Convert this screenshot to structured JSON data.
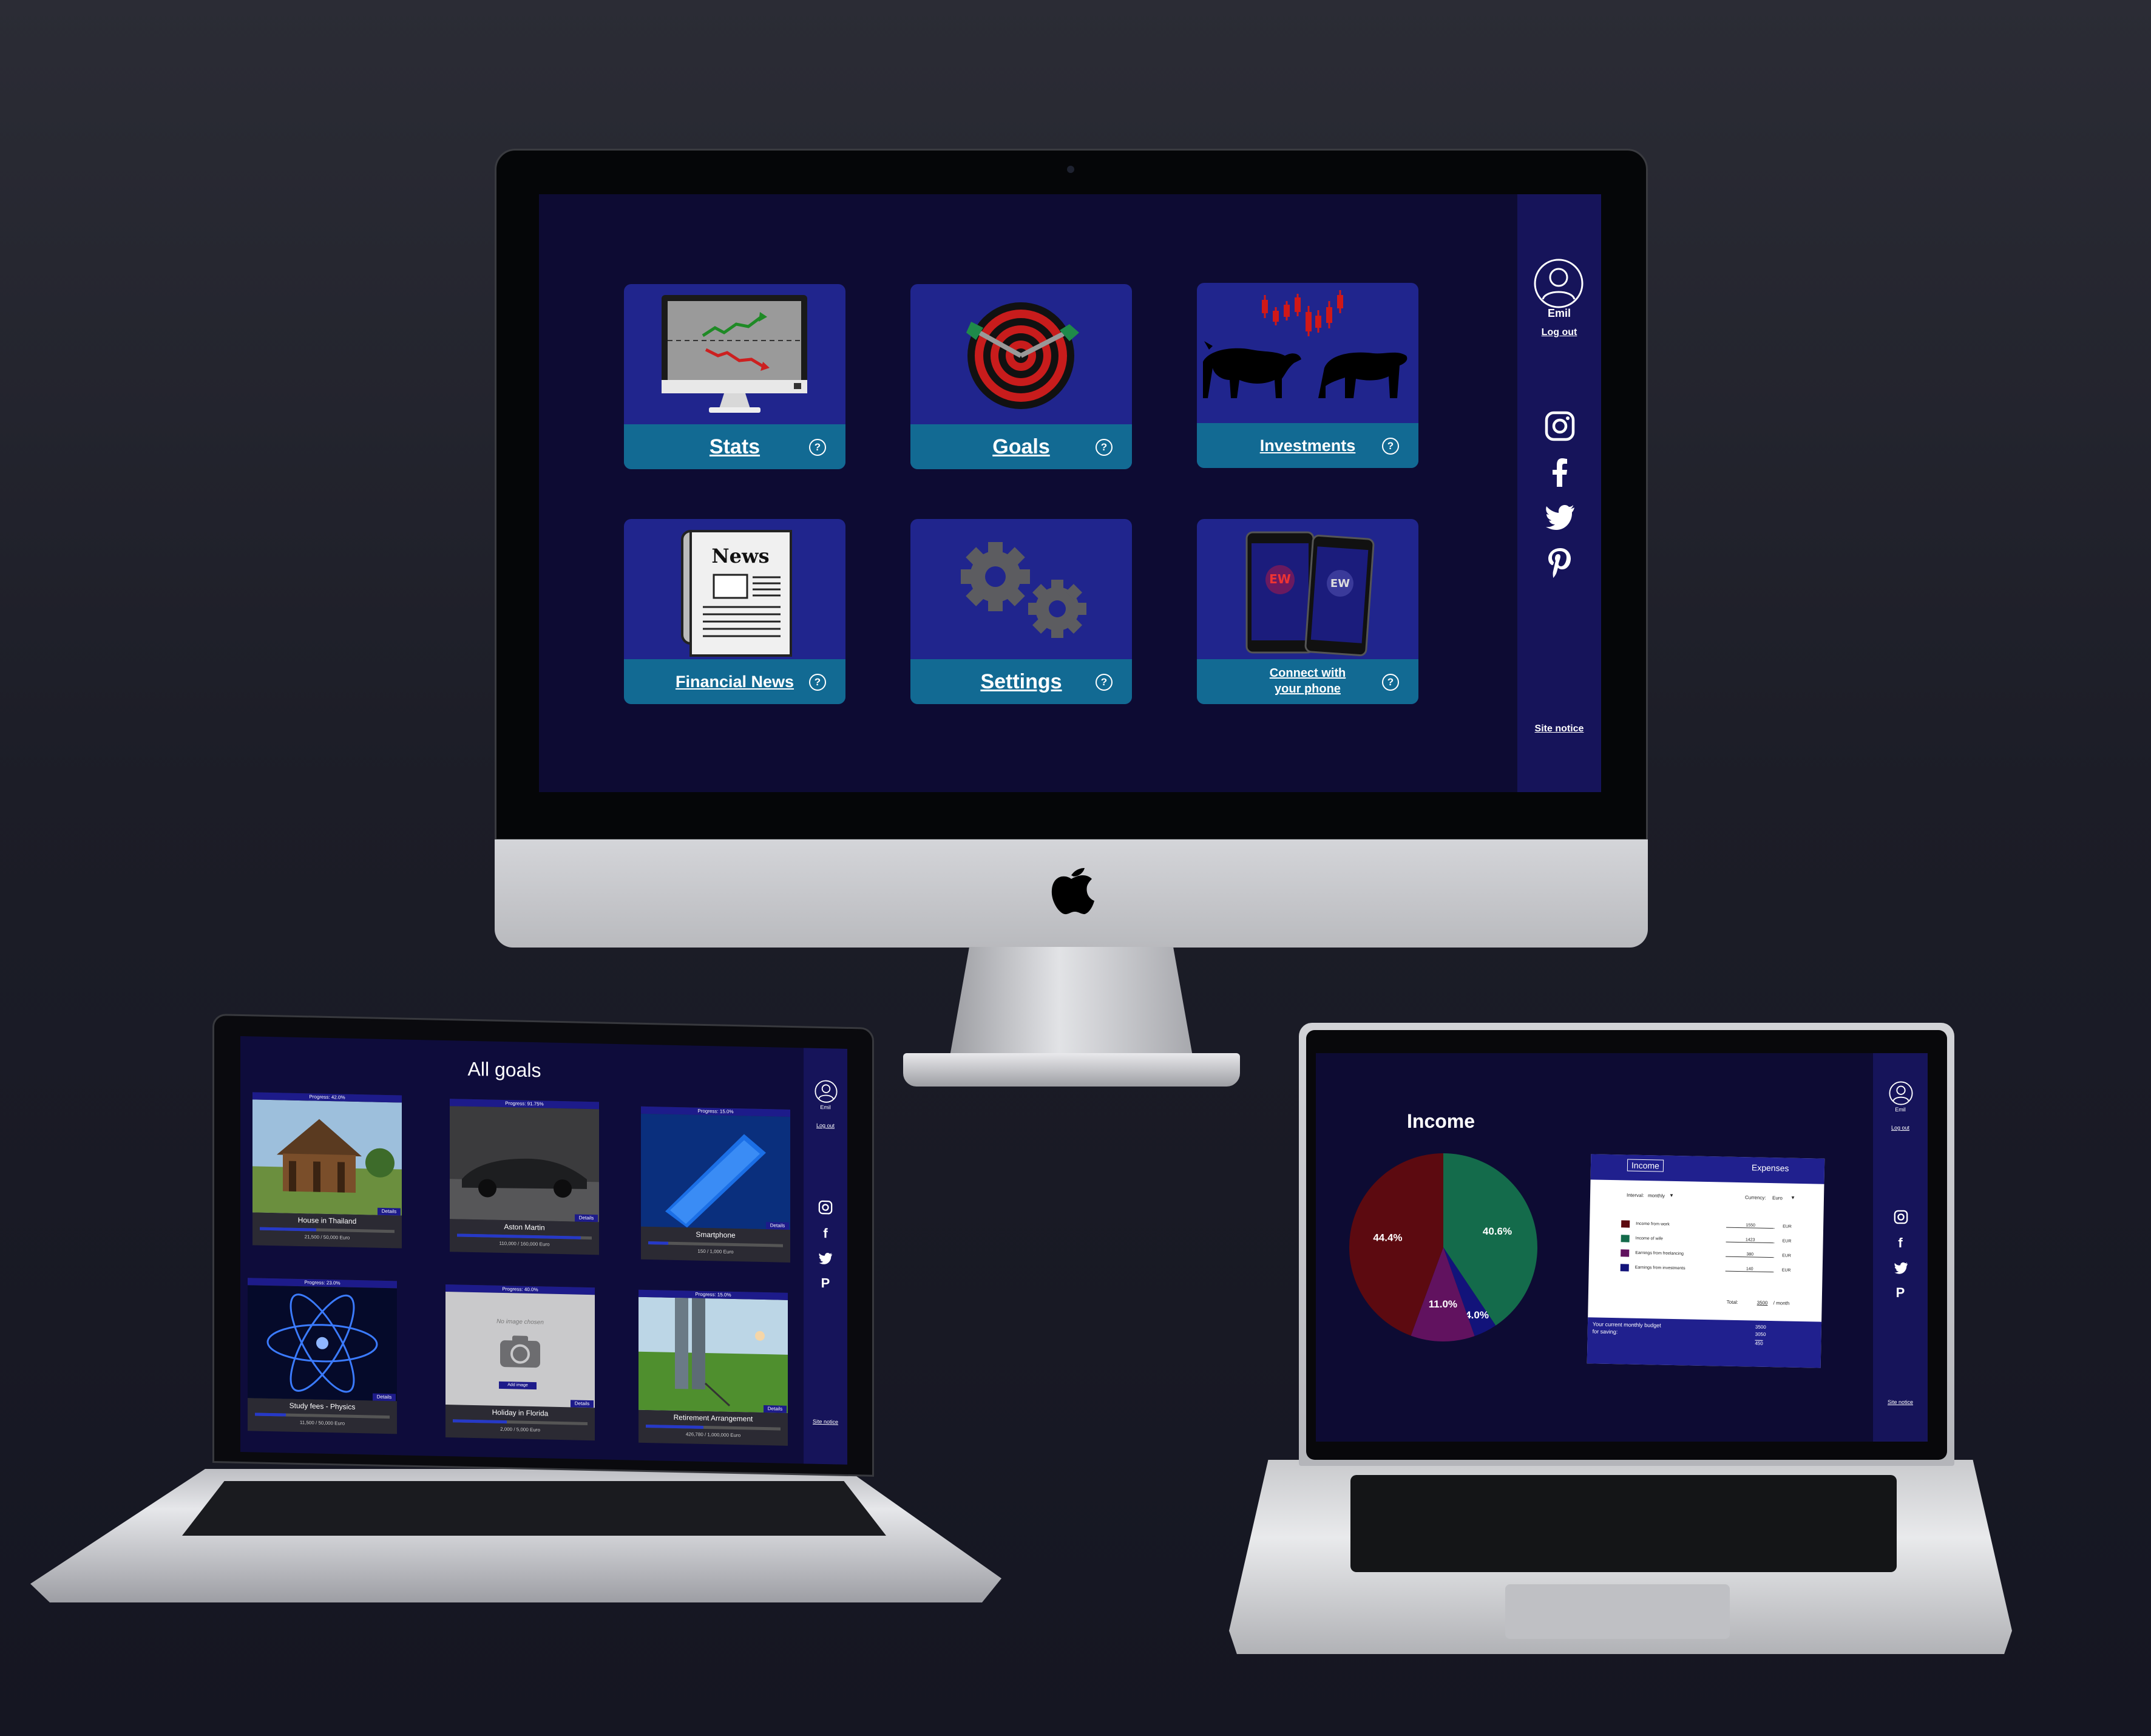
{
  "colors": {
    "tile_blue": "#20258d",
    "tile_bar": "#126a93",
    "screen_bg": "#0d0b33",
    "sidebar": "#16145a",
    "pie_wine": "#5c0a10",
    "pie_green": "#146b4b",
    "pie_purple": "#61125f",
    "pie_navy": "#12137a"
  },
  "imac": {
    "sidebar": {
      "user_name": "Emil",
      "logout": "Log out",
      "site_notice": "Site notice",
      "social_icons": [
        "instagram-icon",
        "facebook-icon",
        "twitter-icon",
        "pinterest-icon"
      ]
    },
    "tiles": [
      {
        "label": "Stats",
        "help": "?",
        "icon": "monitor-chart-icon"
      },
      {
        "label": "Goals",
        "help": "?",
        "icon": "dartboard-icon"
      },
      {
        "label": "Investments",
        "help": "?",
        "icon": "bull-bear-icon"
      },
      {
        "label": "Financial News",
        "help": "?",
        "icon": "newspaper-icon",
        "news_word": "News"
      },
      {
        "label": "Settings",
        "help": "?",
        "icon": "gears-icon"
      },
      {
        "label_line1": "Connect with",
        "label_line2": "your phone",
        "help": "?",
        "icon": "phones-icon"
      }
    ]
  },
  "goals_laptop": {
    "title": "All goals",
    "sidebar": {
      "user_name": "Emil",
      "logout": "Log out",
      "site_notice": "Site notice"
    },
    "cards": [
      {
        "progress": "Progress: 42.0%",
        "name": "House in Thailand",
        "amount": "21,500 / 50,000 Euro",
        "progress_value": 0.42,
        "details": "Details"
      },
      {
        "progress": "Progress: 91.75%",
        "name": "Aston Martin",
        "amount": "110,000 / 160,000 Euro",
        "progress_value": 0.9175,
        "details": "Details"
      },
      {
        "progress": "Progress: 15.0%",
        "name": "Smartphone",
        "amount": "150 / 1,000 Euro",
        "progress_value": 0.15,
        "details": "Details"
      },
      {
        "progress": "Progress: 23.0%",
        "name": "Study fees - Physics",
        "amount": "11,500 / 50,000 Euro",
        "progress_value": 0.23,
        "details": "Details"
      },
      {
        "progress": "Progress: 40.0%",
        "name": "Holiday in Florida",
        "amount": "2,000 / 5,000 Euro",
        "progress_value": 0.4,
        "details": "Details",
        "no_image": "No image chosen",
        "add_image": "Add image"
      },
      {
        "progress": "Progress: 15.0%",
        "name": "Retirement Arrangement",
        "amount": "426,780 / 1,000,000 Euro",
        "progress_value": 0.43,
        "details": "Details"
      }
    ]
  },
  "income_laptop": {
    "title": "Income",
    "sidebar": {
      "user_name": "Emil",
      "logout": "Log out",
      "site_notice": "Site notice"
    },
    "chart_data": {
      "type": "pie",
      "title": "Income",
      "slices": [
        {
          "label": "40.6%",
          "value": 40.6,
          "color": "#146b4b"
        },
        {
          "label": "4.0%",
          "value": 4.0,
          "color": "#12137a"
        },
        {
          "label": "11.0%",
          "value": 11.0,
          "color": "#61125f"
        },
        {
          "label": "44.4%",
          "value": 44.4,
          "color": "#5c0a10"
        }
      ]
    },
    "panel": {
      "tab_income": "Income",
      "tab_expenses": "Expenses",
      "interval_label": "Interval:",
      "interval_value": "monthly",
      "currency_label": "Currency:",
      "currency_value": "Euro",
      "rows": [
        {
          "name": "Income from work",
          "amount": "1550",
          "cur": "EUR",
          "color": "#5c0a10"
        },
        {
          "name": "Income of wife",
          "amount": "1423",
          "cur": "EUR",
          "color": "#146b4b"
        },
        {
          "name": "Earnings from freelancing",
          "amount": "380",
          "cur": "EUR",
          "color": "#61125f"
        },
        {
          "name": "Earnings from investments",
          "amount": "140",
          "cur": "EUR",
          "color": "#12137a"
        }
      ],
      "total_label": "Total:",
      "total_value": "3500",
      "total_unit": "/ month",
      "budget_line1": "Your current monthly budget",
      "budget_line2": "for saving:",
      "budget_values": [
        "3500",
        "3050",
        "450"
      ]
    }
  }
}
